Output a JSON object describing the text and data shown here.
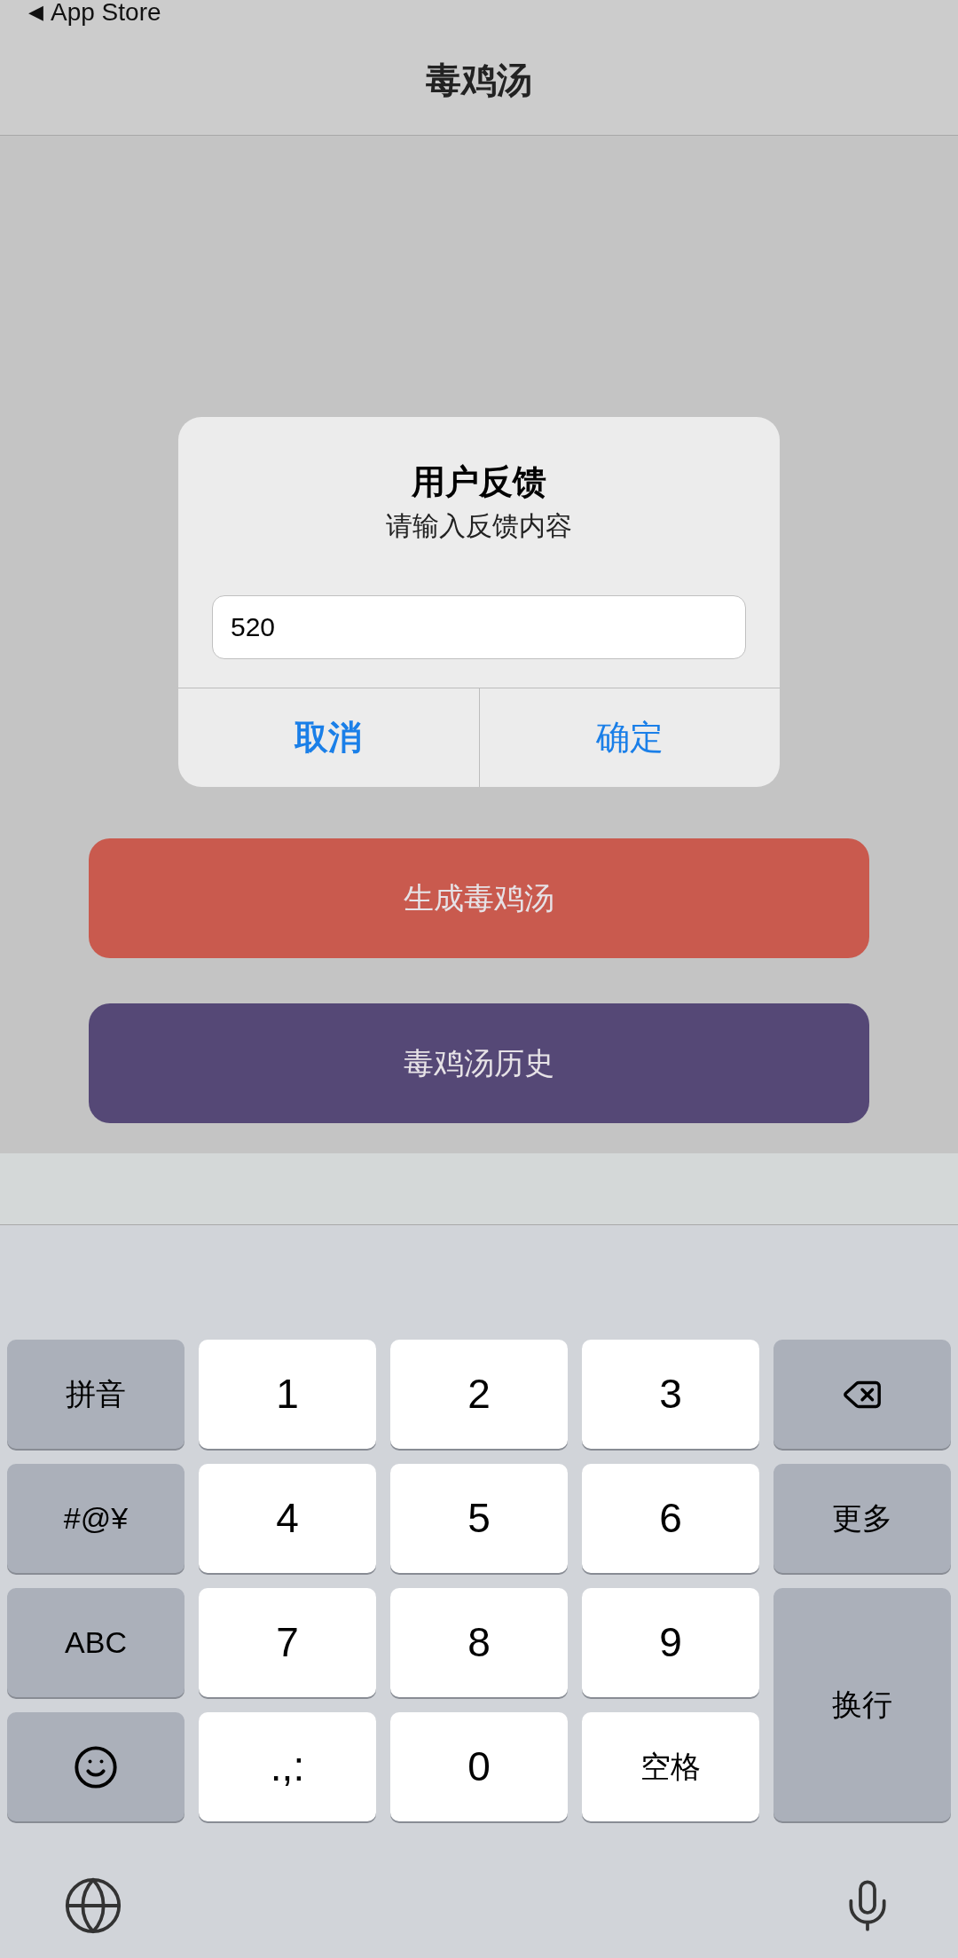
{
  "status_bar": {
    "back_arrow": "◀",
    "back_label": "App Store"
  },
  "nav_bar": {
    "title": "毒鸡汤"
  },
  "dialog": {
    "title": "用户反馈",
    "message": "请输入反馈内容",
    "input": {
      "value": "520"
    },
    "buttons": [
      {
        "label": "取消",
        "kind": "cancel"
      },
      {
        "label": "确定",
        "kind": "default"
      }
    ]
  },
  "main_buttons": [
    {
      "label": "生成毒鸡汤",
      "color": "#c95a4e"
    },
    {
      "label": "毒鸡汤历史",
      "color": "#554876"
    }
  ],
  "keyboard": {
    "keys": [
      {
        "kind": "function",
        "label": "拼音"
      },
      {
        "kind": "character",
        "label": "1"
      },
      {
        "kind": "character",
        "label": "2"
      },
      {
        "kind": "character",
        "label": "3"
      },
      {
        "kind": "delete"
      },
      {
        "kind": "function",
        "label": "#@¥"
      },
      {
        "kind": "character",
        "label": "4"
      },
      {
        "kind": "character",
        "label": "5"
      },
      {
        "kind": "character",
        "label": "6"
      },
      {
        "kind": "function",
        "label": "更多"
      },
      {
        "kind": "function",
        "label": "ABC"
      },
      {
        "kind": "character",
        "label": "7"
      },
      {
        "kind": "character",
        "label": "8"
      },
      {
        "kind": "character",
        "label": "9"
      },
      {
        "kind": "return",
        "label": "换行"
      },
      {
        "kind": "emoji"
      },
      {
        "kind": "character",
        "label": ".,:"
      },
      {
        "kind": "character",
        "label": "0"
      },
      {
        "kind": "space",
        "label": "空格"
      }
    ]
  }
}
